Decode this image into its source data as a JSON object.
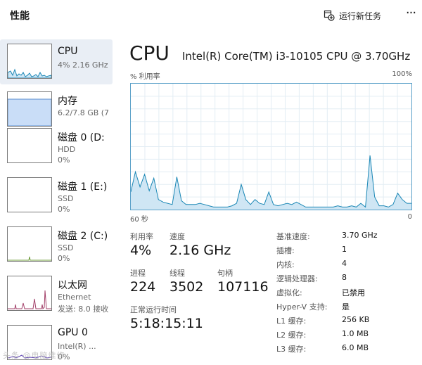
{
  "header": {
    "title": "性能",
    "run_task_label": "运行新任务",
    "more_icon": "ellipsis-icon",
    "more_glyph": "···"
  },
  "sidebar": {
    "items": [
      {
        "name": "CPU",
        "sub1": "4% 2.16 GHz",
        "sub2": "",
        "graph": "cpu",
        "selected": true
      },
      {
        "name": "内存",
        "sub1": "6.2/7.8 GB (7",
        "sub2": "",
        "graph": "memory",
        "selected": false
      },
      {
        "name": "磁盘 0 (D:",
        "sub1": "HDD",
        "sub2": "0%",
        "graph": "empty",
        "selected": false
      },
      {
        "name": "磁盘 1 (E:)",
        "sub1": "SSD",
        "sub2": "0%",
        "graph": "empty",
        "selected": false
      },
      {
        "name": "磁盘 2 (C:)",
        "sub1": "SSD",
        "sub2": "0%",
        "graph": "disk2",
        "selected": false
      },
      {
        "name": "以太网",
        "sub1": "Ethernet",
        "sub2": "发送: 8.0  接收",
        "graph": "ethernet",
        "selected": false
      },
      {
        "name": "GPU 0",
        "sub1": "Intel(R) ...",
        "sub2": "0%",
        "graph": "gpu",
        "selected": false
      }
    ]
  },
  "main": {
    "title": "CPU",
    "model": "Intel(R) Core(TM) i3-10105 CPU @ 3.70GHz",
    "axis_top_left": "% 利用率",
    "axis_top_right": "100%",
    "axis_bottom_left": "60 秒",
    "axis_bottom_right": "0"
  },
  "chart_data": {
    "type": "area",
    "ylabel": "% 利用率",
    "xlabel": "60 秒",
    "ylim": [
      0,
      100
    ],
    "x_range_seconds": [
      60,
      0
    ],
    "values": [
      14,
      30,
      18,
      28,
      15,
      25,
      8,
      6,
      5,
      4,
      26,
      7,
      4,
      4,
      4,
      5,
      4,
      3,
      2,
      2,
      2,
      2,
      3,
      5,
      20,
      8,
      4,
      8,
      5,
      4,
      14,
      4,
      3,
      4,
      5,
      4,
      6,
      4,
      2,
      2,
      2,
      2,
      2,
      2,
      2,
      3,
      2,
      2,
      3,
      2,
      5,
      2,
      43,
      10,
      3,
      3,
      2,
      4,
      13,
      8,
      5,
      5
    ]
  },
  "stats": {
    "utilization_label": "利用率",
    "utilization_value": "4%",
    "speed_label": "速度",
    "speed_value": "2.16 GHz",
    "processes_label": "进程",
    "processes_value": "224",
    "threads_label": "线程",
    "threads_value": "3502",
    "handles_label": "句柄",
    "handles_value": "107116",
    "uptime_label": "正常运行时间",
    "uptime_value": "5:18:15:11"
  },
  "specs": [
    {
      "label": "基准速度:",
      "value": "3.70 GHz"
    },
    {
      "label": "插槽:",
      "value": "1"
    },
    {
      "label": "内核:",
      "value": "4"
    },
    {
      "label": "逻辑处理器:",
      "value": "8"
    },
    {
      "label": "虚拟化:",
      "value": "已禁用"
    },
    {
      "label": "Hyper-V 支持:",
      "value": "是"
    },
    {
      "label": "L1 缓存:",
      "value": "256 KB"
    },
    {
      "label": "L2 缓存:",
      "value": "1.0 MB"
    },
    {
      "label": "L3 缓存:",
      "value": "6.0 MB"
    }
  ],
  "colors": {
    "cpu_line": "#1a87b5",
    "cpu_fill": "#cfe6f4",
    "memory_fill": "#c9ddf7",
    "memory_line": "#5b8fd1",
    "disk_line": "#6f9c3b",
    "ethernet_line": "#a3416a",
    "gpu_line": "#5b3fb0"
  },
  "watermark": "头条 @电脑维修"
}
